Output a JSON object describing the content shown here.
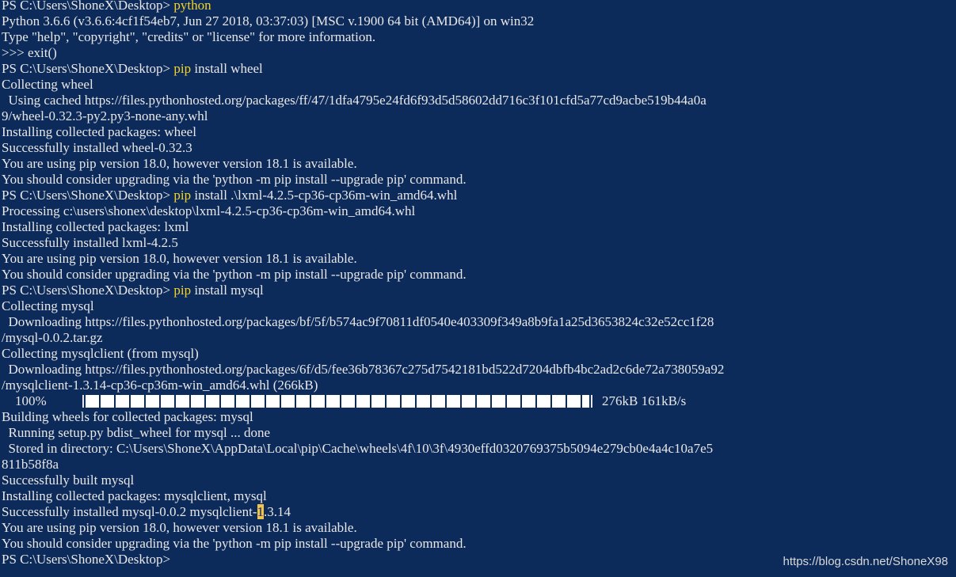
{
  "terminal": {
    "bg": "#0c2a5a",
    "fg": "#e8e8e8",
    "accent": "#f5d32a",
    "lines": [
      {
        "prompt": "PS C:\\Users\\ShoneX\\Desktop> ",
        "cmd": "python",
        "rest": ""
      },
      {
        "text": "Python 3.6.6 (v3.6.6:4cf1f54eb7, Jun 27 2018, 03:37:03) [MSC v.1900 64 bit (AMD64)] on win32"
      },
      {
        "text": "Type \"help\", \"copyright\", \"credits\" or \"license\" for more information."
      },
      {
        "text": ">>> exit()"
      },
      {
        "prompt": "PS C:\\Users\\ShoneX\\Desktop> ",
        "cmd": "pip",
        "rest": " install wheel"
      },
      {
        "text": "Collecting wheel"
      },
      {
        "text": "  Using cached https://files.pythonhosted.org/packages/ff/47/1dfa4795e24fd6f93d5d58602dd716c3f101cfd5a77cd9acbe519b44a0a"
      },
      {
        "text": "9/wheel-0.32.3-py2.py3-none-any.whl"
      },
      {
        "text": "Installing collected packages: wheel"
      },
      {
        "text": "Successfully installed wheel-0.32.3"
      },
      {
        "text": "You are using pip version 18.0, however version 18.1 is available."
      },
      {
        "text": "You should consider upgrading via the 'python -m pip install --upgrade pip' command."
      },
      {
        "prompt": "PS C:\\Users\\ShoneX\\Desktop> ",
        "cmd": "pip",
        "rest": " install .\\lxml-4.2.5-cp36-cp36m-win_amd64.whl"
      },
      {
        "text": "Processing c:\\users\\shonex\\desktop\\lxml-4.2.5-cp36-cp36m-win_amd64.whl"
      },
      {
        "text": "Installing collected packages: lxml"
      },
      {
        "text": "Successfully installed lxml-4.2.5"
      },
      {
        "text": "You are using pip version 18.0, however version 18.1 is available."
      },
      {
        "text": "You should consider upgrading via the 'python -m pip install --upgrade pip' command."
      },
      {
        "prompt": "PS C:\\Users\\ShoneX\\Desktop> ",
        "cmd": "pip",
        "rest": " install mysql"
      },
      {
        "text": "Collecting mysql"
      },
      {
        "text": "  Downloading https://files.pythonhosted.org/packages/bf/5f/b574ac9f70811df0540e403309f349a8b9fa1a25d3653824c32e52cc1f28"
      },
      {
        "text": "/mysql-0.0.2.tar.gz"
      },
      {
        "text": "Collecting mysqlclient (from mysql)"
      },
      {
        "text": "  Downloading https://files.pythonhosted.org/packages/6f/d5/fee36b78367c275d7542181bd522d7204dbfb4bc2ad2c6de72a738059a92"
      },
      {
        "text": "/mysqlclient-1.3.14-cp36-cp36m-win_amd64.whl (266kB)"
      },
      {
        "progress": true
      },
      {
        "text": "Building wheels for collected packages: mysql"
      },
      {
        "text": "  Running setup.py bdist_wheel for mysql ... done"
      },
      {
        "text": "  Stored in directory: C:\\Users\\ShoneX\\AppData\\Local\\pip\\Cache\\wheels\\4f\\10\\3f\\4930effd0320769375b5094e279cb0e4a4c10a7e5"
      },
      {
        "text": "811b58f8a"
      },
      {
        "text": "Successfully built mysql"
      },
      {
        "text": "Installing collected packages: mysqlclient, mysql"
      },
      {
        "highlight": true,
        "before": "Successfully installed mysql-0.0.2 mysqlclient-",
        "mark": "1",
        "after": ".3.14"
      },
      {
        "text": "You are using pip version 18.0, however version 18.1 is available."
      },
      {
        "text": "You should consider upgrading via the 'python -m pip install --upgrade pip' command."
      },
      {
        "prompt": "PS C:\\Users\\ShoneX\\Desktop> ",
        "cmd": "",
        "rest": ""
      }
    ],
    "progress": {
      "percent_label": "    100%",
      "fraction": 1.0,
      "speed_text": "276kB 161kB/s"
    }
  },
  "watermark": "https://blog.csdn.net/ShoneX98"
}
